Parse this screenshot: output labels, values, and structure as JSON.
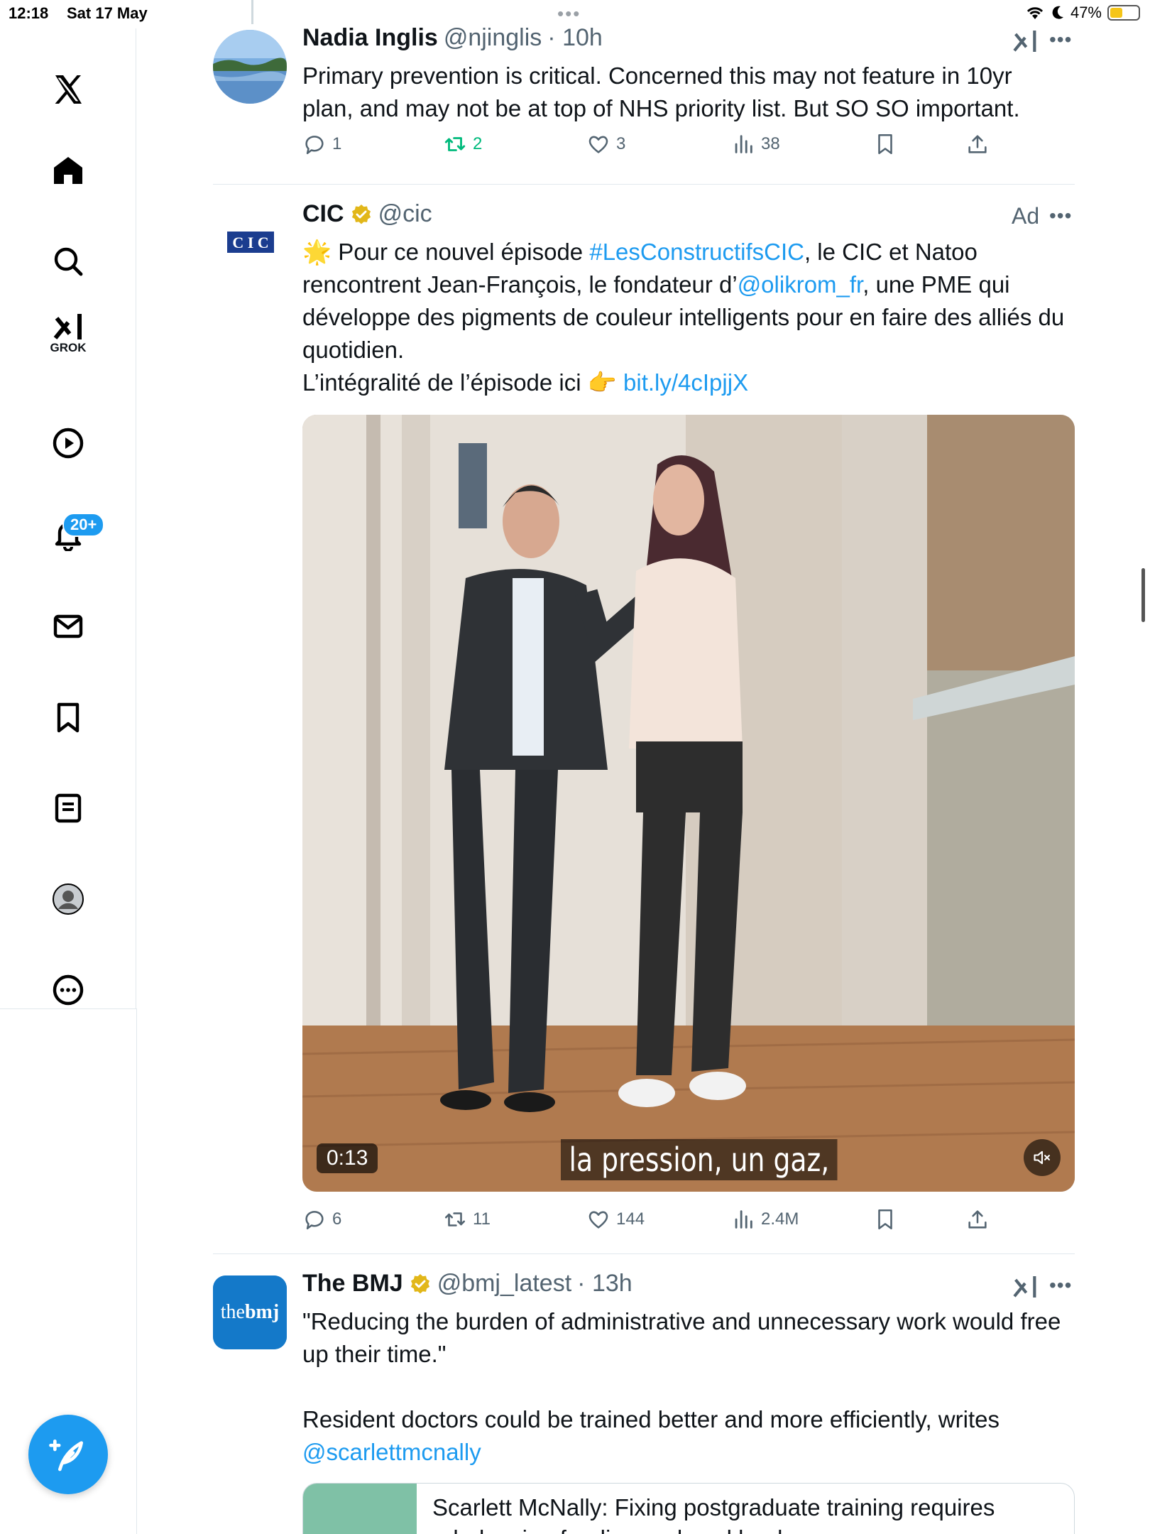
{
  "status_bar": {
    "time": "12:18",
    "date": "Sat 17 May",
    "battery": "47%"
  },
  "sidebar": {
    "grok_label": "GROK",
    "notifications_badge": "20+",
    "items": [
      "x-logo",
      "home-icon",
      "search-icon",
      "grok-icon",
      "video-icon",
      "notifications-icon",
      "messages-icon",
      "bookmarks-icon",
      "lists-icon",
      "profile-icon",
      "more-icon"
    ]
  },
  "tweets": [
    {
      "name": "Nadia Inglis",
      "handle": "@njinglis",
      "time": "· 10h",
      "text": "Primary prevention is critical. Concerned this may not feature in 10yr plan, and may not be at top of NHS priority list. But SO SO important.",
      "replies": "1",
      "retweets": "2",
      "likes": "3",
      "views": "38"
    },
    {
      "name": "CIC",
      "handle": "@cic",
      "ad": "Ad",
      "avatar_text": "CIC",
      "text_parts": {
        "p1": "🌟 Pour ce nouvel épisode ",
        "hashtag": "#LesConstructifsCIC",
        "p2": ", le CIC et Natoo rencontrent Jean-François, le fondateur d’",
        "mention": "@olikrom_fr",
        "p3": ", une PME qui développe des pigments de couleur intelligents pour en faire des alliés du quotidien.",
        "p4": "L’intégralité de l’épisode ici 👉 ",
        "link": "bit.ly/4cIpjjX"
      },
      "video_time": "0:13",
      "subtitle": "la pression, un gaz,",
      "replies": "6",
      "retweets": "11",
      "likes": "144",
      "views": "2.4M"
    },
    {
      "name": "The BMJ",
      "handle": "@bmj_latest",
      "time": "· 13h",
      "avatar_text": "thebmj",
      "text_line1": "\"Reducing the burden of administrative and unnecessary work would free up their time.\"",
      "text_line2": "Resident doctors could be trained better and more efficiently, writes ",
      "mention": "@scarlettmcnally",
      "card_title": "Scarlett McNally: Fixing postgraduate training requires rebalancing funding and workload"
    }
  ],
  "colors": {
    "accent": "#1d9bf0",
    "retweet_green": "#00ba7c",
    "muted": "#536471",
    "verified_gold": "#e2b719",
    "cic_blue": "#1b3d8f",
    "bmj_blue": "#1479c9"
  }
}
